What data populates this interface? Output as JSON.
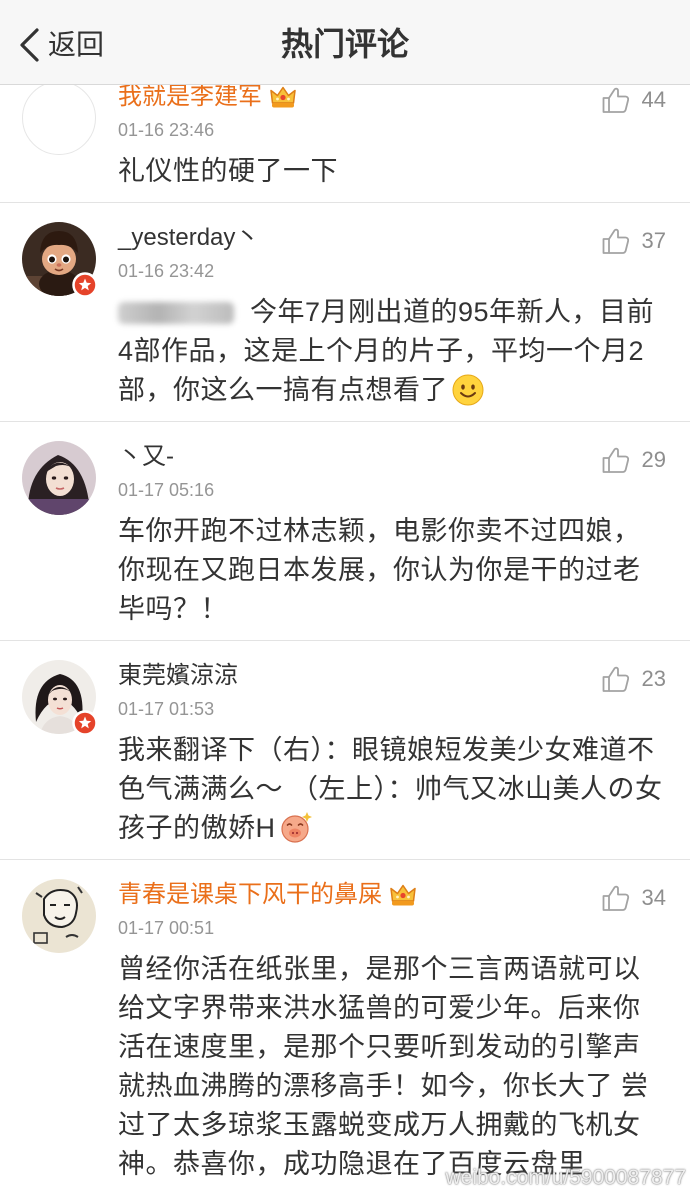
{
  "header": {
    "back_label": "返回",
    "title": "热门评论"
  },
  "comments": [
    {
      "username": "我就是李建军",
      "vip": true,
      "verified_badge": false,
      "time": "01-16 23:46",
      "likes": "44",
      "content": "礼仪性的硬了一下"
    },
    {
      "username": "_yesterday丶",
      "vip": false,
      "verified_badge": true,
      "time": "01-16 23:42",
      "likes": "37",
      "redacted_prefix": true,
      "content": "今年7月刚出道的95年新人，目前4部作品，这是上个月的片子，平均一个月2部，你这么一搞有点想看了",
      "trailing_emoji": "smile-emoji-icon"
    },
    {
      "username": "丶又-",
      "vip": false,
      "verified_badge": false,
      "time": "01-17 05:16",
      "likes": "29",
      "content": "车你开跑不过林志颖，电影你卖不过四娘，你现在又跑日本发展，你认为你是干的过老毕吗？！"
    },
    {
      "username": "東莞嬪涼涼",
      "vip": false,
      "verified_badge": true,
      "time": "01-17 01:53",
      "likes": "23",
      "content": "我来翻译下（右）：眼镜娘短发美少女难道不色气满满么～ （左上）：帅气又冰山美人の女孩子的傲娇H",
      "trailing_emoji": "shy-emoji-icon"
    },
    {
      "username": "青春是课桌下风干的鼻屎",
      "vip": true,
      "verified_badge": false,
      "time": "01-17 00:51",
      "likes": "34",
      "content": "曾经你活在纸张里，是那个三言两语就可以给文字界带来洪水猛兽的可爱少年。后来你活在速度里，是那个只要听到发动的引擎声就热血沸腾的漂移高手！如今，你长大了 尝过了太多琼浆玉露蜕变成万人拥戴的飞机女神。恭喜你，成功隐退在了百度云盘里"
    }
  ],
  "watermark": "weibo.com/u/5900087877",
  "icons": {
    "back": "chevron-left-icon",
    "like": "thumbs-up-icon",
    "vip": "crown-vip-icon",
    "badge": "verified-badge-icon"
  },
  "colors": {
    "vip_name": "#ea6f1a",
    "text": "#333333",
    "meta": "#959595",
    "like": "#8e8e8e",
    "divider": "#e3e3e3",
    "header_bg": "#f7f7f7",
    "badge": "#e5432a"
  }
}
